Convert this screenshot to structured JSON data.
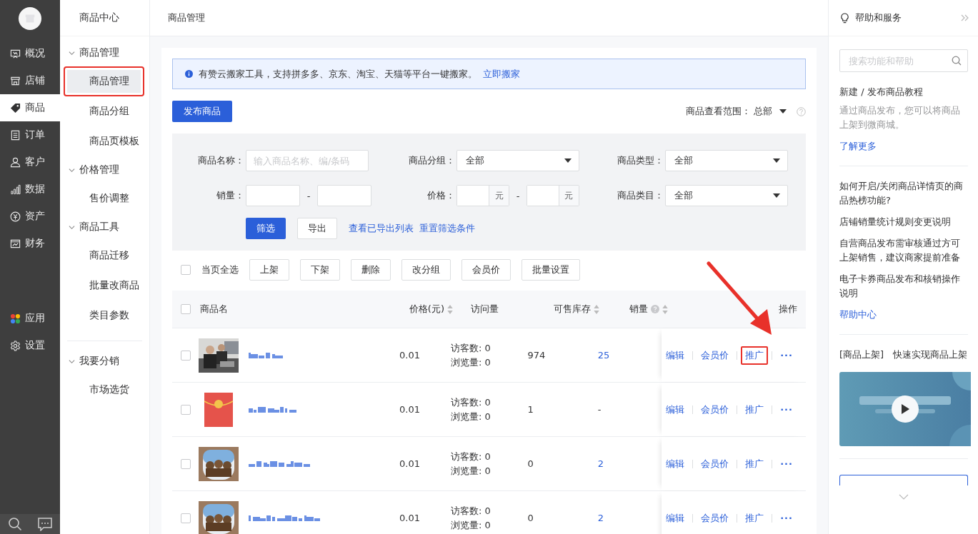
{
  "nav": {
    "items": [
      {
        "label": "概况",
        "selected": false
      },
      {
        "label": "店铺",
        "selected": false
      },
      {
        "label": "商品",
        "selected": true
      },
      {
        "label": "订单",
        "selected": false
      },
      {
        "label": "客户",
        "selected": false
      },
      {
        "label": "数据",
        "selected": false
      },
      {
        "label": "资产",
        "selected": false
      },
      {
        "label": "财务",
        "selected": false
      }
    ],
    "bottom_items": [
      {
        "label": "应用",
        "selected": false
      },
      {
        "label": "设置",
        "selected": false
      }
    ]
  },
  "subnav": {
    "title": "商品中心",
    "groups": [
      {
        "label": "商品管理",
        "expanded": true,
        "divider_before": false,
        "children": [
          {
            "label": "商品管理",
            "selected": true,
            "highlighted": true
          },
          {
            "label": "商品分组",
            "selected": false,
            "highlighted": false
          },
          {
            "label": "商品页模板",
            "selected": false,
            "highlighted": false
          }
        ]
      },
      {
        "label": "价格管理",
        "expanded": true,
        "divider_before": false,
        "children": [
          {
            "label": "售价调整",
            "selected": false,
            "highlighted": false
          }
        ]
      },
      {
        "label": "商品工具",
        "expanded": true,
        "divider_before": false,
        "children": [
          {
            "label": "商品迁移",
            "selected": false,
            "highlighted": false
          },
          {
            "label": "批量改商品",
            "selected": false,
            "highlighted": false
          },
          {
            "label": "类目参数",
            "selected": false,
            "highlighted": false
          }
        ]
      },
      {
        "label": "我要分销",
        "expanded": true,
        "divider_before": true,
        "children": [
          {
            "label": "市场选货",
            "selected": false,
            "highlighted": false
          }
        ]
      }
    ]
  },
  "header": {
    "title": "商品管理"
  },
  "notice": {
    "text": "有赞云搬家工具，支持拼多多、京东、淘宝、天猫等平台一键搬家。",
    "link": "立即搬家"
  },
  "publish_button": "发布商品",
  "scope": {
    "label": "商品查看范围：",
    "value": "总部"
  },
  "filters": {
    "name": {
      "label": "商品名称：",
      "placeholder": "输入商品名称、编/条码"
    },
    "group": {
      "label": "商品分组：",
      "value": "全部"
    },
    "type": {
      "label": "商品类型：",
      "value": "全部"
    },
    "sales": {
      "label": "销量：",
      "separator": "-"
    },
    "price": {
      "label": "价格：",
      "unit_min": "元",
      "separator": "-",
      "unit_max": "元"
    },
    "category": {
      "label": "商品类目：",
      "value": "全部"
    },
    "buttons": [
      "筛选",
      "导出"
    ],
    "links": [
      "查看已导出列表",
      "重置筛选条件"
    ]
  },
  "batch": {
    "select_all": {
      "label": "当页全选",
      "checked": false
    },
    "buttons": [
      "上架",
      "下架",
      "删除",
      "改分组",
      "会员价",
      "批量设置"
    ]
  },
  "table": {
    "columns": [
      {
        "label": "商品名"
      },
      {
        "label": "价格(元)",
        "sortable": true
      },
      {
        "label": "访问量"
      },
      {
        "label": "可售库存",
        "sortable": true
      },
      {
        "label": "销量",
        "sortable": true,
        "help": true
      },
      {
        "label": "操作"
      }
    ],
    "header_checked": false,
    "rows": [
      {
        "checked": false,
        "price": "0.01",
        "visitors": "访客数: 0",
        "views": "浏览量: 0",
        "stock": "974",
        "sales": "25",
        "sales_link": true,
        "actions": [
          {
            "label": "编辑",
            "highlighted": false
          },
          {
            "label": "会员价",
            "highlighted": false
          },
          {
            "label": "推广",
            "highlighted": true
          }
        ],
        "more": "···"
      },
      {
        "checked": false,
        "price": "0.01",
        "visitors": "访客数: 0",
        "views": "浏览量: 0",
        "stock": "1",
        "sales": "-",
        "sales_link": false,
        "actions": [
          {
            "label": "编辑",
            "highlighted": false
          },
          {
            "label": "会员价",
            "highlighted": false
          },
          {
            "label": "推广",
            "highlighted": false
          }
        ],
        "more": "···"
      },
      {
        "checked": false,
        "price": "0.01",
        "visitors": "访客数: 0",
        "views": "浏览量: 0",
        "stock": "0",
        "sales": "2",
        "sales_link": true,
        "actions": [
          {
            "label": "编辑",
            "highlighted": false
          },
          {
            "label": "会员价",
            "highlighted": false
          },
          {
            "label": "推广",
            "highlighted": false
          }
        ],
        "more": "···"
      },
      {
        "checked": false,
        "price": "0.01",
        "visitors": "访客数: 0",
        "views": "浏览量: 0",
        "stock": "0",
        "sales": "2",
        "sales_link": true,
        "actions": [
          {
            "label": "编辑",
            "highlighted": false
          },
          {
            "label": "会员价",
            "highlighted": false
          },
          {
            "label": "推广",
            "highlighted": false
          }
        ],
        "more": "···"
      }
    ]
  },
  "annotation_arrow": true,
  "help_panel": {
    "title": "帮助和服务",
    "search_placeholder": "搜索功能和帮助",
    "tutorial": {
      "title": "新建 / 发布商品教程",
      "text": "通过商品发布，您可以将商品上架到微商城。",
      "link": "了解更多"
    },
    "articles": [
      "如何开启/关闭商品详情页的商品热榜功能?",
      "店铺销量统计规则变更说明",
      "自营商品发布需审核通过方可上架销售，建议商家提前准备",
      "电子卡券商品发布和核销操作说明"
    ],
    "help_link": "帮助中心",
    "video": {
      "title": "[商品上架]　快速实现商品上架",
      "kind": "picture"
    }
  }
}
